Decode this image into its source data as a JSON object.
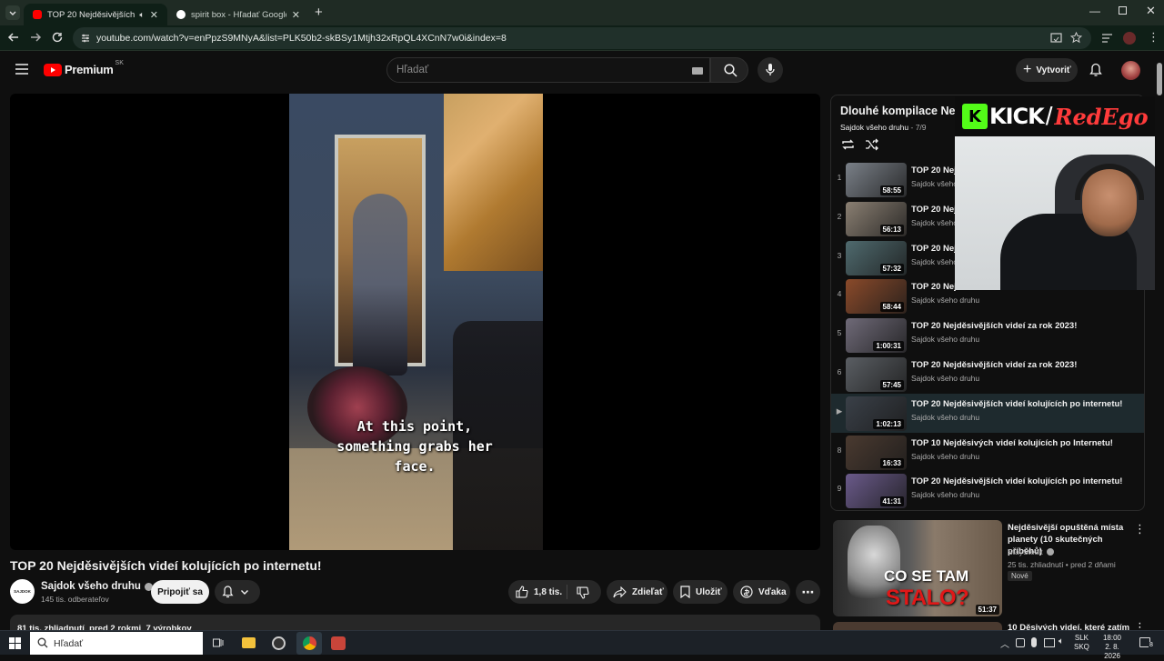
{
  "browser": {
    "tabs": [
      {
        "title": "TOP 20 Nejděsivějších videí",
        "active": true
      },
      {
        "title": "spirit box - Hľadať Googlom",
        "active": false
      }
    ],
    "url": "youtube.com/watch?v=enPpzS9MNyA&list=PLK50b2-skBSy1Mtjh32xRpQL4XCnN7w0i&index=8"
  },
  "header": {
    "logo": "Premium",
    "region": "SK",
    "search_placeholder": "Hľadať",
    "create_label": "Vytvoriť"
  },
  "video": {
    "caption_lines": [
      "At this point,",
      "something grabs her",
      "face."
    ],
    "title": "TOP 20 Nejděsivějších videí kolujících po internetu!",
    "channel": "Sajdok všeho druhu",
    "channel_avatar_text": "SAJDOK",
    "subscribers": "145 tis. odberateľov",
    "join_label": "Pripojiť sa",
    "likes": "1,8 tis.",
    "share_label": "Zdieľať",
    "save_label": "Uložiť",
    "thanks_label": "Vďaka",
    "meta": "81 tis. zhliadnutí  pred 2 rokmi  7 výrobkov"
  },
  "playlist": {
    "title": "Dlouhé kompilace Ne",
    "channel": "Sajdok všeho druhu",
    "position": "- 7/9",
    "items": [
      {
        "num": "1",
        "title": "TOP 20 Nej",
        "channel": "Sajdok všeho",
        "duration": "58:55",
        "color": "#7a8088"
      },
      {
        "num": "2",
        "title": "TOP 20 Nej",
        "channel": "Sajdok všeho",
        "duration": "56:13",
        "color": "#8a7f72"
      },
      {
        "num": "3",
        "title": "TOP 20 Nej",
        "channel": "Sajdok všeho",
        "duration": "57:32",
        "color": "#4f6a6e"
      },
      {
        "num": "4",
        "title": "TOP 20 Nej",
        "channel": "Sajdok všeho druhu",
        "duration": "58:44",
        "color": "#8a4a2a"
      },
      {
        "num": "5",
        "title": "TOP 20 Nejděsivějších videí za rok 2023!",
        "channel": "Sajdok všeho druhu",
        "duration": "1:00:31",
        "color": "#6f6a78"
      },
      {
        "num": "6",
        "title": "TOP 20 Nejděsivějších videí za rok 2023!",
        "channel": "Sajdok všeho druhu",
        "duration": "57:45",
        "color": "#5a5e63"
      },
      {
        "num": "▶",
        "title": "TOP 20 Nejděsivějších videí kolujících po internetu!",
        "channel": "Sajdok všeho druhu",
        "duration": "1:02:13",
        "color": "#3a4048",
        "current": true
      },
      {
        "num": "8",
        "title": "TOP 10 Nejděsivých videí kolujících po Internetu!",
        "channel": "Sajdok všeho druhu",
        "duration": "16:33",
        "color": "#4a3a30"
      },
      {
        "num": "9",
        "title": "TOP 20 Nejděsivějších videí kolujících po internetu!",
        "channel": "Sajdok všeho druhu",
        "duration": "41:31",
        "color": "#6a5a8a"
      }
    ]
  },
  "recommended": [
    {
      "title_line1": "Nejděsivější opuštěná místa",
      "title_line2": "planety (10 skutečných příběhů)",
      "channel": "StaySteak",
      "views": "25 tis. zhliadnutí • pred 2 dňami",
      "badge": "Nové",
      "duration": "51:37",
      "thumb_text1": "CO SE TAM",
      "thumb_text2": "STALO?"
    },
    {
      "title_line1": "10 Děsivých videí, které zatím"
    }
  ],
  "overlay": {
    "brand": "KICK",
    "slash": "/",
    "name": "RedEgo"
  },
  "taskbar": {
    "search_placeholder": "Hľadať",
    "lang1": "SLK",
    "lang2": "SKQ",
    "time": "18:00",
    "date": "2. 8. 2026",
    "notifications": "8"
  }
}
